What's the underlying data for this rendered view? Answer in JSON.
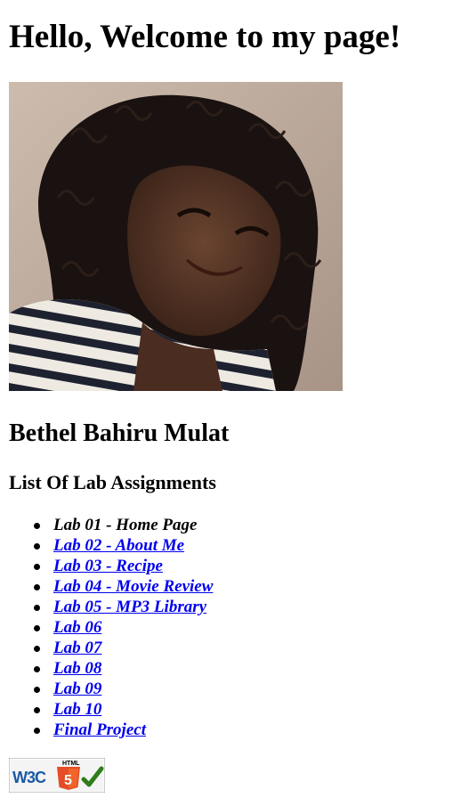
{
  "heading": "Hello, Welcome to my page!",
  "name": "Bethel Bahiru Mulat",
  "list_title": "List Of Lab Assignments",
  "labs": [
    {
      "label": "Lab 01 - Home Page",
      "link": false
    },
    {
      "label": "Lab 02 - About Me",
      "link": true
    },
    {
      "label": "Lab 03 - Recipe",
      "link": true
    },
    {
      "label": "Lab 04 - Movie Review",
      "link": true
    },
    {
      "label": "Lab 05 - MP3 Library",
      "link": true
    },
    {
      "label": "Lab 06",
      "link": true
    },
    {
      "label": "Lab 07",
      "link": true
    },
    {
      "label": "Lab 08",
      "link": true
    },
    {
      "label": "Lab 09",
      "link": true
    },
    {
      "label": "Lab 10",
      "link": true
    },
    {
      "label": "Final Project",
      "link": true
    }
  ],
  "badge": {
    "w3c_text": "W3C",
    "html_text": "HTML",
    "html_number": "5"
  },
  "colors": {
    "link": "#0000ee",
    "text": "#000000",
    "html5_orange": "#e44d26",
    "check_green": "#2e7d1a"
  }
}
